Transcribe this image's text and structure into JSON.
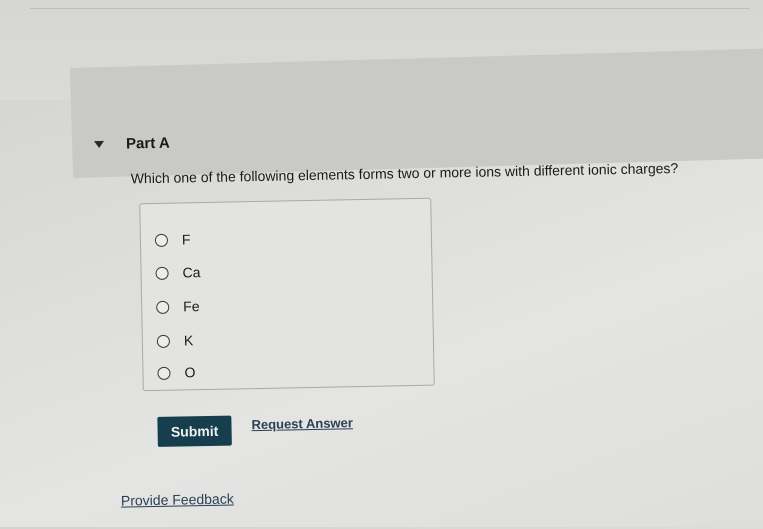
{
  "part": {
    "title": "Part A",
    "toggle_icon": "caret-down-icon"
  },
  "question": {
    "text": "Which one of the following elements forms two or more ions with different ionic charges?"
  },
  "options": [
    {
      "label": "F",
      "selected": false
    },
    {
      "label": "Ca",
      "selected": false
    },
    {
      "label": "Fe",
      "selected": false
    },
    {
      "label": "K",
      "selected": false
    },
    {
      "label": "O",
      "selected": false
    }
  ],
  "actions": {
    "submit_label": "Submit",
    "request_answer_label": "Request Answer"
  },
  "footer": {
    "feedback_label": "Provide Feedback"
  },
  "colors": {
    "submit_bg": "#163e4c",
    "link": "#2b3f55"
  }
}
